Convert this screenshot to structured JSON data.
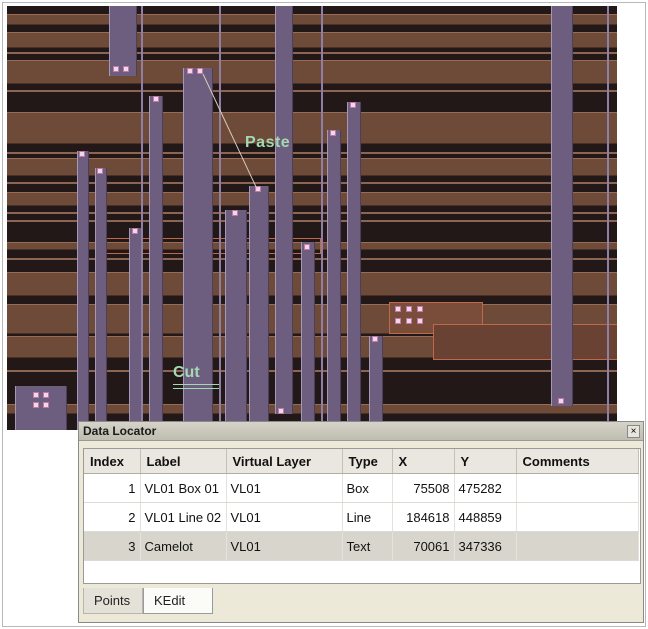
{
  "canvas": {
    "labels": {
      "paste": "Paste",
      "cut": "Cut"
    }
  },
  "data_locator": {
    "title": "Data Locator",
    "close_glyph": "×",
    "columns": [
      "Index",
      "Label",
      "Virtual Layer",
      "Type",
      "X",
      "Y",
      "Comments"
    ],
    "rows": [
      {
        "index": "1",
        "label": "VL01 Box 01",
        "virtual_layer": "VL01",
        "type": "Box",
        "x": "75508",
        "y": "475282",
        "comments": ""
      },
      {
        "index": "2",
        "label": "VL01 Line 02",
        "virtual_layer": "VL01",
        "type": "Line",
        "x": "184618",
        "y": "448859",
        "comments": ""
      },
      {
        "index": "3",
        "label": "Camelot",
        "virtual_layer": "VL01",
        "type": "Text",
        "x": "70061",
        "y": "347336",
        "comments": ""
      }
    ],
    "selected_row": 3,
    "tabs": [
      {
        "label": "Points",
        "active": false
      },
      {
        "label": "KEdit",
        "active": true
      }
    ]
  },
  "colors": {
    "layout_background": "#221818",
    "metal_stripe": "#6e4a38",
    "vertical_bar": "#6d5d7e",
    "annotation_text": "#a3d9b2",
    "panel_background": "#ece9d8"
  }
}
